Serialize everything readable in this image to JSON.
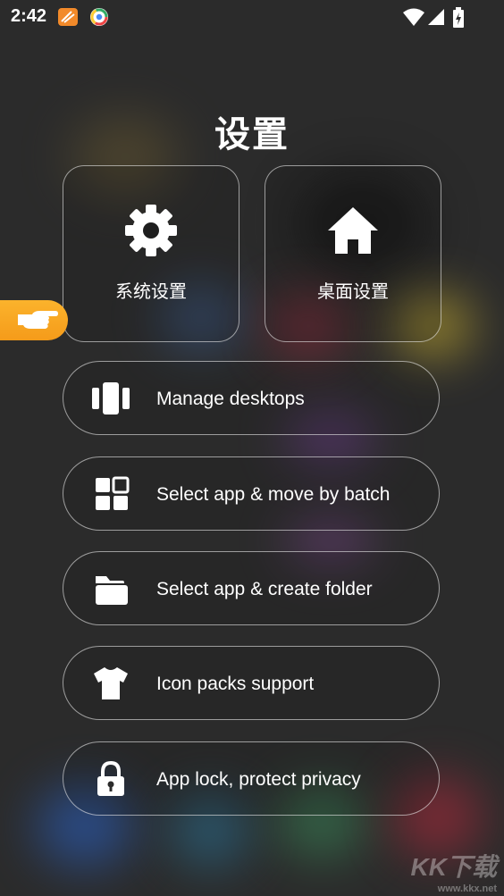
{
  "status_bar": {
    "time": "2:42"
  },
  "title": "设置",
  "cards": [
    {
      "label": "系统设置",
      "icon": "gear-icon"
    },
    {
      "label": "桌面设置",
      "icon": "home-icon"
    }
  ],
  "rows": [
    {
      "label": "Manage desktops",
      "icon": "desktops-icon"
    },
    {
      "label": "Select app & move by batch",
      "icon": "grid-icon"
    },
    {
      "label": "Select app & create folder",
      "icon": "folder-icon"
    },
    {
      "label": "Icon packs support",
      "icon": "tshirt-icon"
    },
    {
      "label": "App lock, protect privacy",
      "icon": "lock-icon"
    }
  ],
  "watermark": {
    "brand": "KK下载",
    "url": "www.kkx.net"
  }
}
